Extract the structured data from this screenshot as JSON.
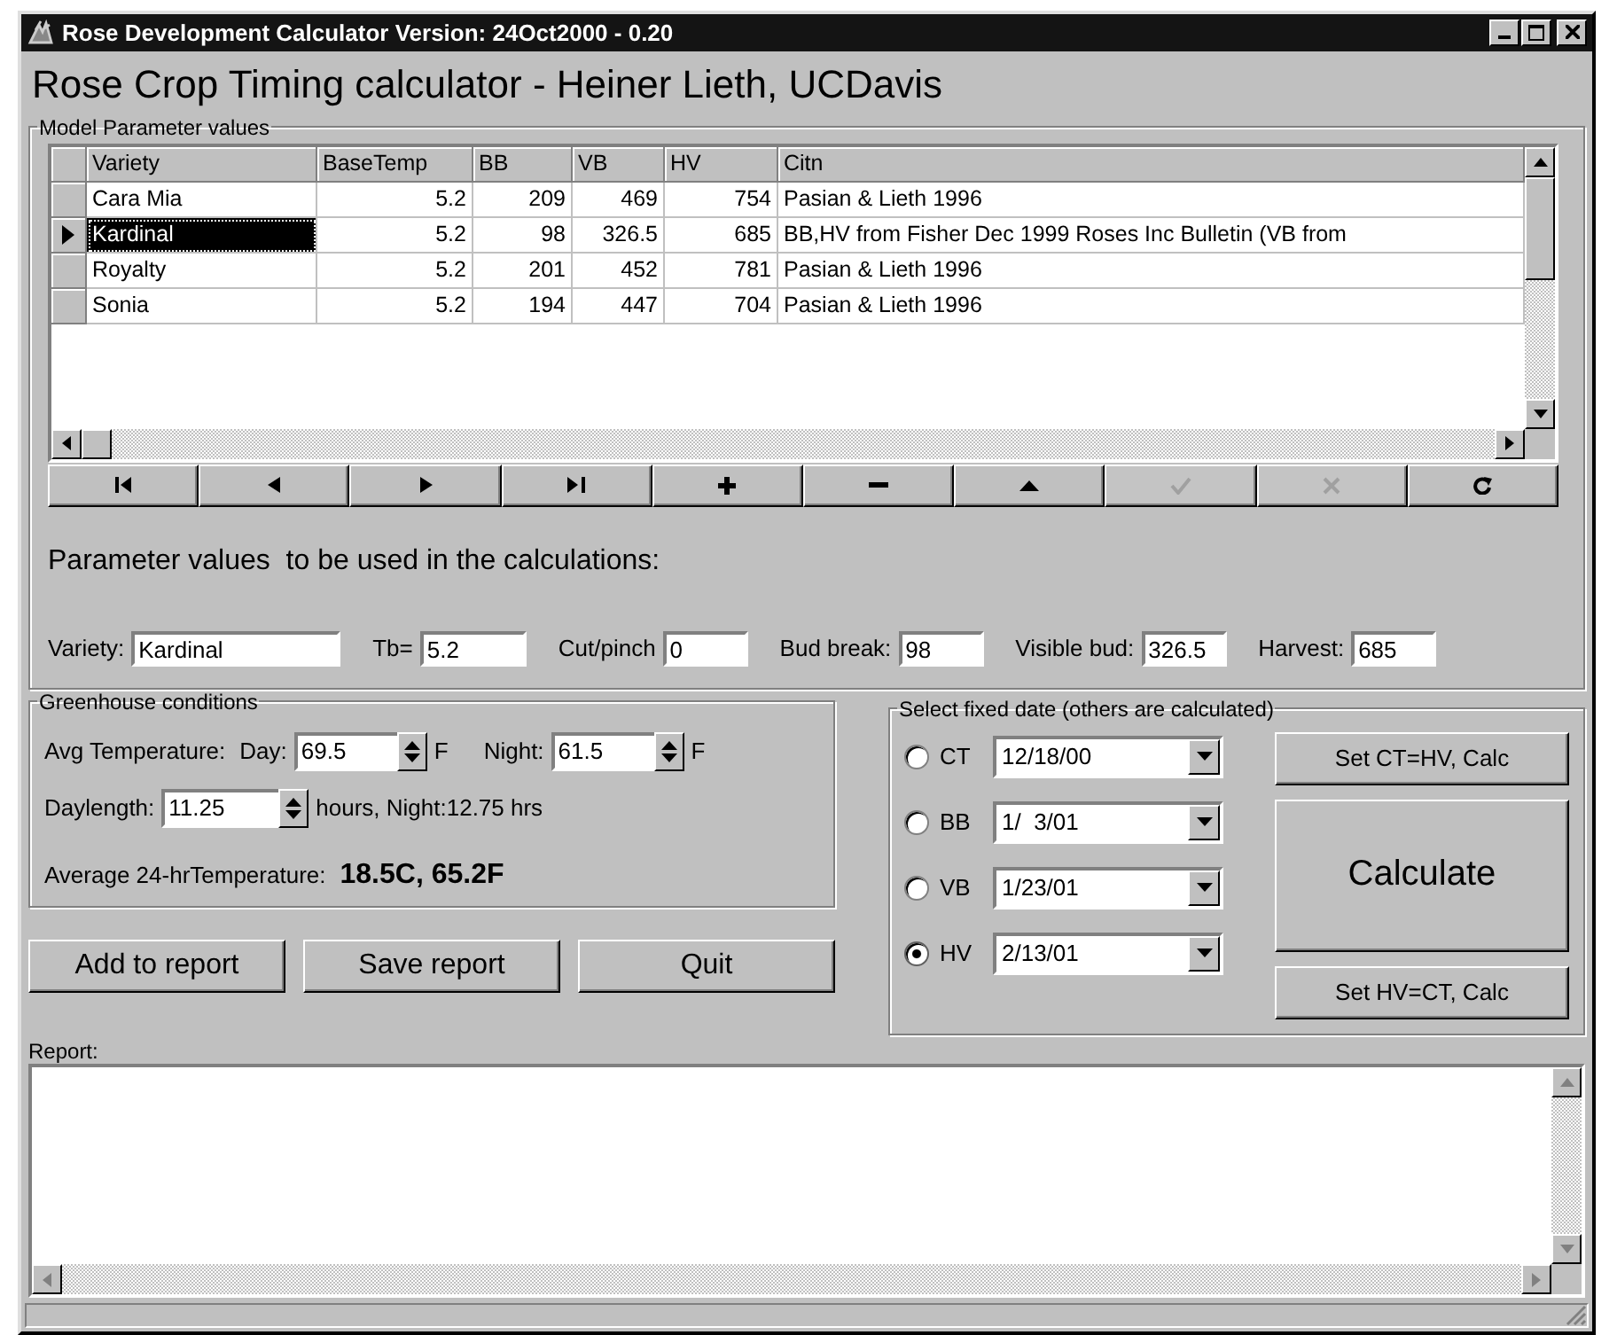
{
  "window": {
    "title": "Rose Development Calculator Version: 24Oct2000 - 0.20"
  },
  "heading": "Rose Crop Timing calculator - Heiner Lieth, UCDavis",
  "model_group": {
    "label": "Model Parameter values",
    "columns": [
      "Variety",
      "BaseTemp",
      "BB",
      "VB",
      "HV",
      "Citn"
    ],
    "rows": [
      {
        "cells": [
          "Cara Mia",
          "5.2",
          "209",
          "469",
          "754",
          "Pasian & Lieth 1996"
        ],
        "selected": false
      },
      {
        "cells": [
          "Kardinal",
          "5.2",
          "98",
          "326.5",
          "685",
          "BB,HV from Fisher Dec 1999 Roses Inc Bulletin (VB from"
        ],
        "selected": true
      },
      {
        "cells": [
          "Royalty",
          "5.2",
          "201",
          "452",
          "781",
          "Pasian & Lieth 1996"
        ],
        "selected": false
      },
      {
        "cells": [
          "Sonia",
          "5.2",
          "194",
          "447",
          "704",
          "Pasian & Lieth 1996"
        ],
        "selected": false
      }
    ]
  },
  "navigator": [
    {
      "kind": "first",
      "disabled": false
    },
    {
      "kind": "prior",
      "disabled": false
    },
    {
      "kind": "next",
      "disabled": false
    },
    {
      "kind": "last",
      "disabled": false
    },
    {
      "kind": "insert",
      "disabled": false
    },
    {
      "kind": "delete",
      "disabled": false
    },
    {
      "kind": "edit",
      "disabled": false
    },
    {
      "kind": "post",
      "disabled": true
    },
    {
      "kind": "cancel",
      "disabled": true
    },
    {
      "kind": "refresh",
      "disabled": false
    }
  ],
  "parameters": {
    "heading": "Parameter values  to be used in the calculations:",
    "fields": [
      {
        "label": "Variety:",
        "value": "Kardinal",
        "kind": "wide"
      },
      {
        "label": "Tb=",
        "value": "5.2",
        "kind": "medium"
      },
      {
        "label": "Cut/pinch",
        "value": "0",
        "kind": "narrow"
      },
      {
        "label": "Bud break:",
        "value": "98",
        "kind": "narrow"
      },
      {
        "label": "Visible bud:",
        "value": "326.5",
        "kind": "narrow"
      },
      {
        "label": "Harvest:",
        "value": "685",
        "kind": "narrow"
      }
    ]
  },
  "greenhouse": {
    "label": "Greenhouse conditions",
    "avg_label": "Avg Temperature:",
    "day_label": "Day:",
    "day_value": "69.5",
    "day_unit": "F",
    "night_label": "Night:",
    "night_value": "61.5",
    "night_unit": "F",
    "daylength_label": "Daylength:",
    "daylength_value": "11.25",
    "daylength_note": "hours, Night:12.75 hrs",
    "average_label": "Average 24-hrTemperature:",
    "average_value": "18.5C, 65.2F"
  },
  "actions": [
    "Add to report",
    "Save report",
    "Quit"
  ],
  "fixed_date": {
    "label": "Select fixed date (others are calculated)",
    "options": [
      {
        "label": "CT",
        "date": "12/18/00",
        "selected": false
      },
      {
        "label": "BB",
        "date": "1/  3/01",
        "selected": false
      },
      {
        "label": "VB",
        "date": "1/23/01",
        "selected": false
      },
      {
        "label": "HV",
        "date": "2/13/01",
        "selected": true
      }
    ],
    "set_ct": "Set CT=HV, Calc",
    "calculate": "Calculate",
    "set_hv": "Set HV=CT, Calc"
  },
  "report": {
    "label": "Report:"
  }
}
